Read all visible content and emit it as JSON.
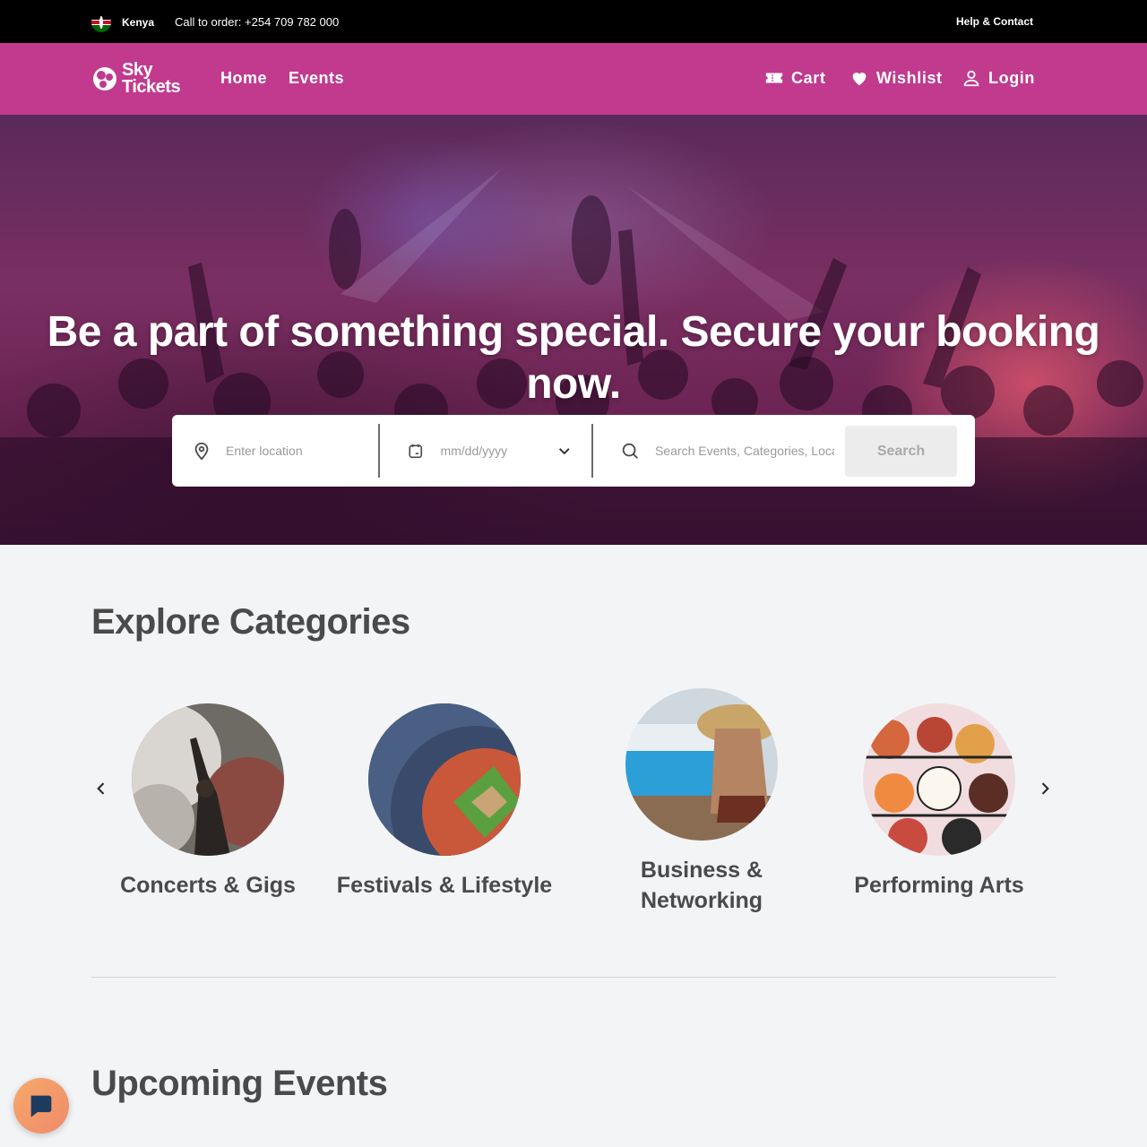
{
  "topbar": {
    "country": "Kenya",
    "phone": "Call to order: +254 709 782 000",
    "help": "Help & Contact"
  },
  "nav": {
    "logo_line1": "Sky",
    "logo_line2": "Tickets",
    "links": [
      "Home",
      "Events"
    ],
    "cart": "Cart",
    "wishlist": "Wishlist",
    "login": "Login"
  },
  "hero": {
    "headline": "Be a part of something special. Secure your booking now.",
    "location_placeholder": "Enter location",
    "date_placeholder": "mm/dd/yyyy",
    "search_placeholder": "Search Events, Categories, Location,...",
    "search_button": "Search"
  },
  "categories": {
    "title": "Explore Categories",
    "items": [
      {
        "label": "Concerts & Gigs"
      },
      {
        "label": "Festivals & Lifestyle"
      },
      {
        "label": "Business & Networking"
      },
      {
        "label": "Performing Arts"
      }
    ]
  },
  "upcoming": {
    "title": "Upcoming Events"
  },
  "colors": {
    "brand": "#c13a8e",
    "topbar": "#000000",
    "background": "#f3f4f6"
  },
  "icons": [
    "kenya-flag-icon",
    "sky-tickets-logo",
    "ticket-icon",
    "heart-icon",
    "user-icon",
    "map-pin-icon",
    "calendar-icon",
    "chevron-down-icon",
    "search-icon",
    "chevron-left-icon",
    "chevron-right-icon",
    "chat-icon"
  ]
}
